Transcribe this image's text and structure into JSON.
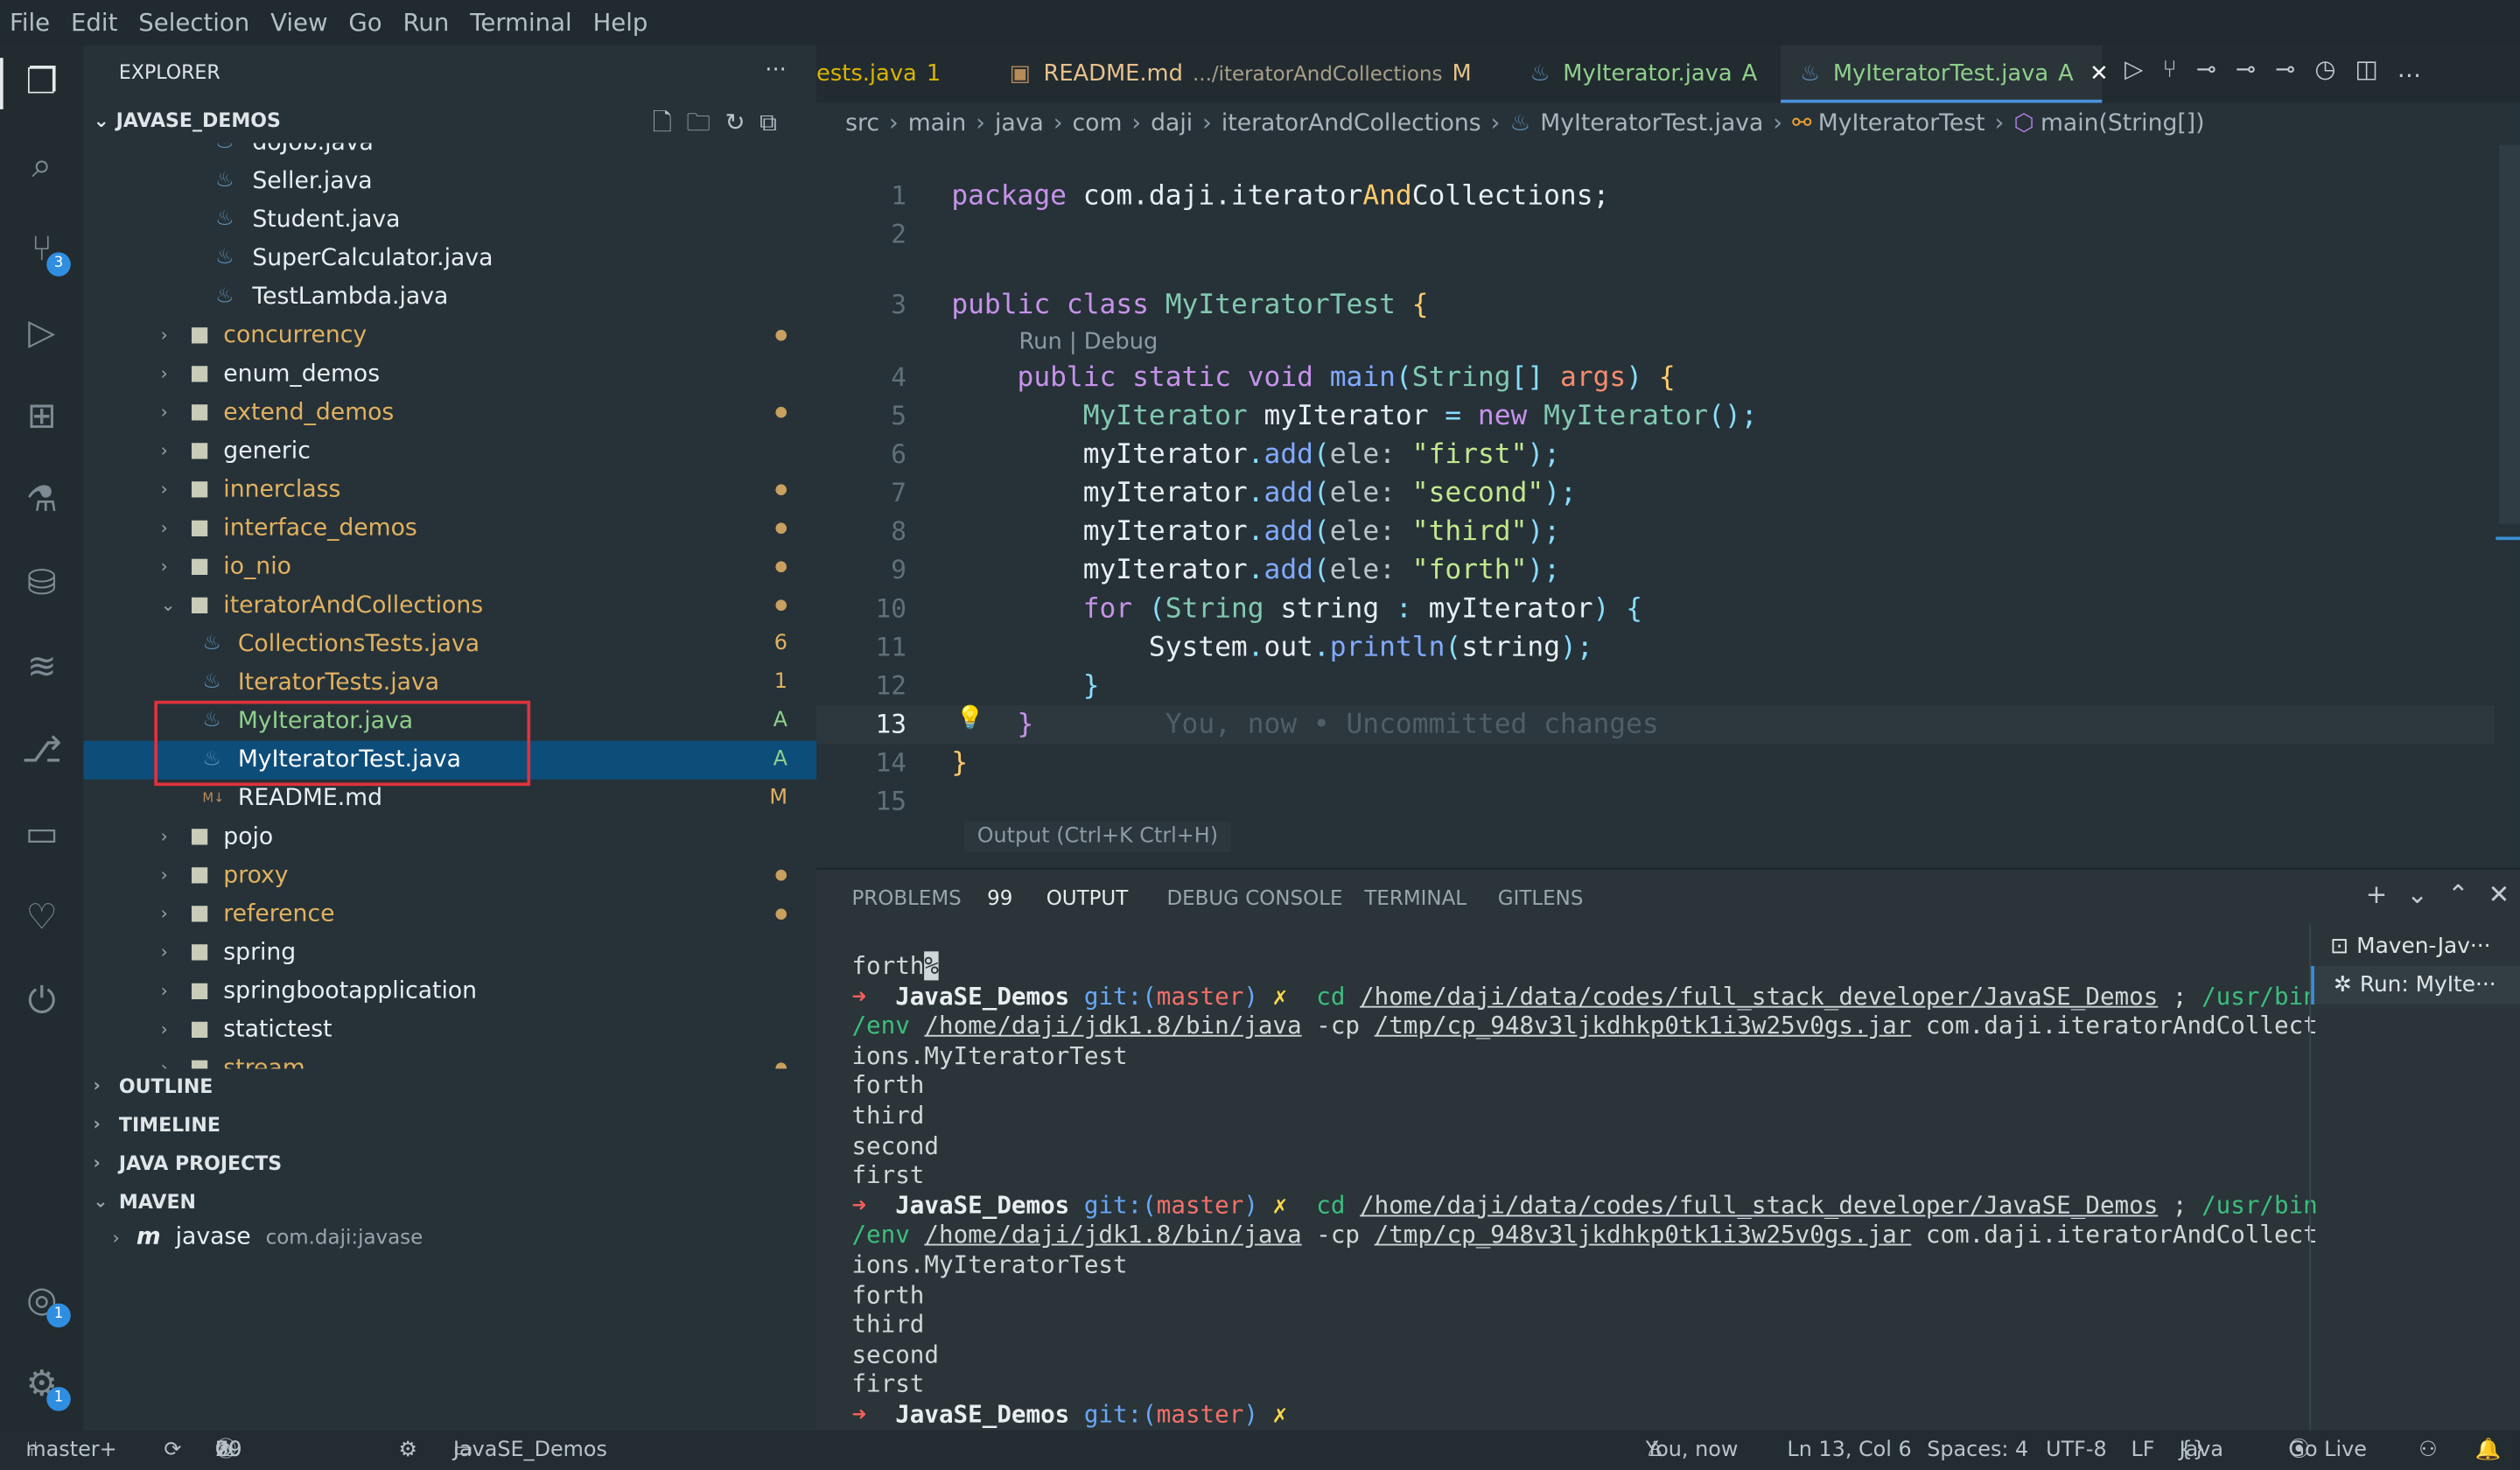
{
  "menu": [
    "File",
    "Edit",
    "Selection",
    "View",
    "Go",
    "Run",
    "Terminal",
    "Help"
  ],
  "activity": [
    {
      "name": "explorer-icon",
      "glyph": "❐",
      "active": true
    },
    {
      "name": "search-icon",
      "glyph": "⌕"
    },
    {
      "name": "source-control-icon",
      "glyph": "⑂",
      "badge": "3"
    },
    {
      "name": "run-debug-icon",
      "glyph": "▷"
    },
    {
      "name": "extensions-icon",
      "glyph": "⊞"
    },
    {
      "name": "testing-icon",
      "glyph": "⚗"
    },
    {
      "name": "database-icon",
      "glyph": "⛁"
    },
    {
      "name": "layers-icon",
      "glyph": "≋"
    },
    {
      "name": "gitlens-icon",
      "glyph": "⎇"
    },
    {
      "name": "folder-icon",
      "glyph": "▭"
    },
    {
      "name": "remote-icon",
      "glyph": "♡"
    },
    {
      "name": "power-icon",
      "glyph": "⏻"
    },
    {
      "name": "account-icon",
      "glyph": "◎",
      "badge": "1"
    },
    {
      "name": "settings-gear-icon",
      "glyph": "⚙",
      "badge": "1"
    }
  ],
  "explorer": {
    "title": "EXPLORER",
    "more": "···",
    "root": "JAVASE_DEMOS",
    "tree": [
      {
        "label": "doJob.java",
        "kind": "java",
        "depth": 3,
        "color": "#e8eef1"
      },
      {
        "label": "Seller.java",
        "kind": "java",
        "depth": 3,
        "color": "#e8eef1"
      },
      {
        "label": "Student.java",
        "kind": "java",
        "depth": 3,
        "color": "#e8eef1"
      },
      {
        "label": "SuperCalculator.java",
        "kind": "java",
        "depth": 3,
        "color": "#e8eef1"
      },
      {
        "label": "TestLambda.java",
        "kind": "java",
        "depth": 3,
        "color": "#e8eef1"
      },
      {
        "label": "concurrency",
        "kind": "folder",
        "depth": 2,
        "color": "#e2b15f",
        "dot": true
      },
      {
        "label": "enum_demos",
        "kind": "folder",
        "depth": 2,
        "color": "#e8eef1"
      },
      {
        "label": "extend_demos",
        "kind": "folder",
        "depth": 2,
        "color": "#e2b15f",
        "dot": true
      },
      {
        "label": "generic",
        "kind": "folder",
        "depth": 2,
        "color": "#e8eef1"
      },
      {
        "label": "innerclass",
        "kind": "folder",
        "depth": 2,
        "color": "#e2b15f",
        "dot": true
      },
      {
        "label": "interface_demos",
        "kind": "folder",
        "depth": 2,
        "color": "#e2b15f",
        "dot": true
      },
      {
        "label": "io_nio",
        "kind": "folder",
        "depth": 2,
        "color": "#e2b15f",
        "dot": true
      },
      {
        "label": "iteratorAndCollections",
        "kind": "folder-open",
        "depth": 2,
        "color": "#e2b15f",
        "dot": true
      },
      {
        "label": "CollectionsTests.java",
        "kind": "java",
        "depth": 4,
        "color": "#e2b15f",
        "status": "6"
      },
      {
        "label": "IteratorTests.java",
        "kind": "java",
        "depth": 4,
        "color": "#e2b15f",
        "status": "1"
      },
      {
        "label": "MyIterator.java",
        "kind": "java",
        "depth": 4,
        "color": "#8fcf8a",
        "status": "A"
      },
      {
        "label": "MyIteratorTest.java",
        "kind": "java",
        "depth": 4,
        "color": "#ffffff",
        "status": "A",
        "selected": true
      },
      {
        "label": "README.md",
        "kind": "md",
        "depth": 4,
        "color": "#e8eef1",
        "status": "M"
      },
      {
        "label": "pojo",
        "kind": "folder",
        "depth": 2,
        "color": "#e8eef1"
      },
      {
        "label": "proxy",
        "kind": "folder",
        "depth": 2,
        "color": "#e2b15f",
        "dot": true
      },
      {
        "label": "reference",
        "kind": "folder",
        "depth": 2,
        "color": "#e2b15f",
        "dot": true
      },
      {
        "label": "spring",
        "kind": "folder",
        "depth": 2,
        "color": "#e8eef1"
      },
      {
        "label": "springbootapplication",
        "kind": "folder",
        "depth": 2,
        "color": "#e8eef1"
      },
      {
        "label": "statictest",
        "kind": "folder",
        "depth": 2,
        "color": "#e8eef1"
      },
      {
        "label": "stream",
        "kind": "folder",
        "depth": 2,
        "color": "#e2b15f",
        "dot": true
      }
    ],
    "sections": [
      "OUTLINE",
      "TIMELINE",
      "JAVA PROJECTS",
      "MAVEN"
    ],
    "maven_item": {
      "label": "javase",
      "detail": "com.daji:javase"
    },
    "highlight_color": "#e0323c"
  },
  "tabs": [
    {
      "label": "ests.java",
      "suffix": "1",
      "color": "#d9b400"
    },
    {
      "label": "README.md",
      "detail": ".../iteratorAndCollections",
      "suffix": "M",
      "color": "#e6c18c"
    },
    {
      "label": "MyIterator.java",
      "suffix": "A",
      "color": "#8fcf8a"
    },
    {
      "label": "MyIteratorTest.java",
      "suffix": "A",
      "color": "#8fcf8a",
      "active": true
    }
  ],
  "breadcrumbs": [
    "src",
    "main",
    "java",
    "com",
    "daji",
    "iteratorAndCollections",
    "MyIteratorTest.java",
    "MyIteratorTest",
    "main(String[])"
  ],
  "codelens": "Run | Debug",
  "hover": "Output (Ctrl+K Ctrl+H)",
  "code": [
    {
      "n": "1",
      "t": [
        [
          "package ",
          "kw"
        ],
        [
          "com.daji.iterator",
          "id"
        ],
        [
          "And",
          "br"
        ],
        [
          "Collections;",
          "id"
        ]
      ]
    },
    {
      "n": "2",
      "t": []
    },
    {
      "n": "3",
      "t": [
        [
          "public ",
          "kw"
        ],
        [
          "class ",
          "kw"
        ],
        [
          "MyIteratorTest ",
          "ty"
        ],
        [
          "{",
          "br"
        ]
      ]
    },
    {
      "n": "4",
      "t": [
        [
          "    public ",
          "kw"
        ],
        [
          "static ",
          "kw"
        ],
        [
          "void ",
          "kw"
        ],
        [
          "main",
          "fn"
        ],
        [
          "(",
          "pu"
        ],
        [
          "String",
          "ty"
        ],
        [
          "[] ",
          "pu"
        ],
        [
          "args",
          "arg"
        ],
        [
          ") ",
          "pu"
        ],
        [
          "{",
          "br"
        ]
      ]
    },
    {
      "n": "5",
      "t": [
        [
          "        MyIterator ",
          "ty"
        ],
        [
          "myIterator ",
          "id"
        ],
        [
          "= ",
          "pu"
        ],
        [
          "new ",
          "kw"
        ],
        [
          "MyIterator",
          "ty"
        ],
        [
          "();",
          "pu"
        ]
      ]
    },
    {
      "n": "6",
      "t": [
        [
          "        myIterator",
          "id"
        ],
        [
          ".",
          "pu"
        ],
        [
          "add",
          "fn"
        ],
        [
          "(",
          "pu"
        ],
        [
          "ele: ",
          "pm"
        ],
        [
          "\"first\"",
          "str"
        ],
        [
          ");",
          "pu"
        ]
      ]
    },
    {
      "n": "7",
      "t": [
        [
          "        myIterator",
          "id"
        ],
        [
          ".",
          "pu"
        ],
        [
          "add",
          "fn"
        ],
        [
          "(",
          "pu"
        ],
        [
          "ele: ",
          "pm"
        ],
        [
          "\"second\"",
          "str"
        ],
        [
          ");",
          "pu"
        ]
      ]
    },
    {
      "n": "8",
      "t": [
        [
          "        myIterator",
          "id"
        ],
        [
          ".",
          "pu"
        ],
        [
          "add",
          "fn"
        ],
        [
          "(",
          "pu"
        ],
        [
          "ele: ",
          "pm"
        ],
        [
          "\"third\"",
          "str"
        ],
        [
          ");",
          "pu"
        ]
      ]
    },
    {
      "n": "9",
      "t": [
        [
          "        myIterator",
          "id"
        ],
        [
          ".",
          "pu"
        ],
        [
          "add",
          "fn"
        ],
        [
          "(",
          "pu"
        ],
        [
          "ele: ",
          "pm"
        ],
        [
          "\"forth\"",
          "str"
        ],
        [
          ");",
          "pu"
        ]
      ]
    },
    {
      "n": "10",
      "t": [
        [
          "        for ",
          "kw"
        ],
        [
          "(",
          "pu"
        ],
        [
          "String ",
          "ty"
        ],
        [
          "string ",
          "id"
        ],
        [
          ": ",
          "pu"
        ],
        [
          "myIterator",
          "id"
        ],
        [
          ") ",
          "pu"
        ],
        [
          "{",
          "pu"
        ]
      ]
    },
    {
      "n": "11",
      "t": [
        [
          "            System",
          "id"
        ],
        [
          ".",
          "pu"
        ],
        [
          "out",
          "id"
        ],
        [
          ".",
          "pu"
        ],
        [
          "println",
          "fn"
        ],
        [
          "(",
          "pu"
        ],
        [
          "string",
          "id"
        ],
        [
          ");",
          "pu"
        ]
      ]
    },
    {
      "n": "12",
      "t": [
        [
          "        }",
          "pu"
        ]
      ]
    },
    {
      "n": "13",
      "t": [
        [
          "    }",
          "kw"
        ],
        [
          "        You, now • Uncommitted changes",
          "gh"
        ]
      ],
      "current": true
    },
    {
      "n": "14",
      "t": [
        [
          "}",
          "br"
        ]
      ]
    },
    {
      "n": "15",
      "t": []
    }
  ],
  "panel": {
    "tabs": [
      {
        "label": "PROBLEMS",
        "count": "99"
      },
      {
        "label": "OUTPUT",
        "active": true
      },
      {
        "label": "DEBUG CONSOLE"
      },
      {
        "label": "TERMINAL"
      },
      {
        "label": "GITLENS"
      }
    ],
    "terminals": [
      "Maven-Jav···",
      "Run: MyIte···"
    ],
    "lines": [
      [
        [
          "forth",
          ""
        ],
        [
          "%",
          "cur"
        ]
      ],
      [
        [
          "➜  ",
          "red"
        ],
        [
          "JavaSE_Demos ",
          "w"
        ],
        [
          "git:(",
          "b"
        ],
        [
          "master",
          "r"
        ],
        [
          ") ",
          "b"
        ],
        [
          "✗  ",
          "y"
        ],
        [
          "cd ",
          "g"
        ],
        [
          "/home/daji/data/codes/full_stack_developer/JavaSE_Demos",
          "u"
        ],
        [
          " ; ",
          ""
        ],
        [
          "/usr/bin",
          "g"
        ]
      ],
      [
        [
          "/env ",
          "g"
        ],
        [
          "/home/daji/jdk1.8/bin/java",
          "u"
        ],
        [
          " -cp ",
          ""
        ],
        [
          "/tmp/cp_948v3ljkdhkp0tk1i3w25v0gs.jar",
          "u"
        ],
        [
          " com.daji.iteratorAndCollect",
          ""
        ]
      ],
      [
        [
          "ions.MyIteratorTest",
          ""
        ]
      ],
      [
        [
          "forth",
          ""
        ]
      ],
      [
        [
          "third",
          ""
        ]
      ],
      [
        [
          "second",
          ""
        ]
      ],
      [
        [
          "first",
          ""
        ]
      ],
      [
        [
          "➜  ",
          "red"
        ],
        [
          "JavaSE_Demos ",
          "w"
        ],
        [
          "git:(",
          "b"
        ],
        [
          "master",
          "r"
        ],
        [
          ") ",
          "b"
        ],
        [
          "✗  ",
          "y"
        ],
        [
          "cd ",
          "g"
        ],
        [
          "/home/daji/data/codes/full_stack_developer/JavaSE_Demos",
          "u"
        ],
        [
          " ; ",
          ""
        ],
        [
          "/usr/bin",
          "g"
        ]
      ],
      [
        [
          "/env ",
          "g"
        ],
        [
          "/home/daji/jdk1.8/bin/java",
          "u"
        ],
        [
          " -cp ",
          ""
        ],
        [
          "/tmp/cp_948v3ljkdhkp0tk1i3w25v0gs.jar",
          "u"
        ],
        [
          " com.daji.iteratorAndCollect",
          ""
        ]
      ],
      [
        [
          "ions.MyIteratorTest",
          ""
        ]
      ],
      [
        [
          "forth",
          ""
        ]
      ],
      [
        [
          "third",
          ""
        ]
      ],
      [
        [
          "second",
          ""
        ]
      ],
      [
        [
          "first",
          ""
        ]
      ],
      [
        [
          "➜  ",
          "red"
        ],
        [
          "JavaSE_Demos ",
          "w"
        ],
        [
          "git:(",
          "b"
        ],
        [
          "master",
          "r"
        ],
        [
          ") ",
          "b"
        ],
        [
          "✗",
          "y"
        ]
      ]
    ]
  },
  "status": {
    "branch": "master+",
    "sync": "⟳",
    "errors": "0",
    "warnings": "70",
    "info": "29",
    "folder": "JavaSE_Demos",
    "blame": "You, now",
    "position": "Ln 13, Col 6",
    "spaces": "Spaces: 4",
    "encoding": "UTF-8",
    "eol": "LF",
    "language": "Java",
    "golive": "Go Live"
  }
}
